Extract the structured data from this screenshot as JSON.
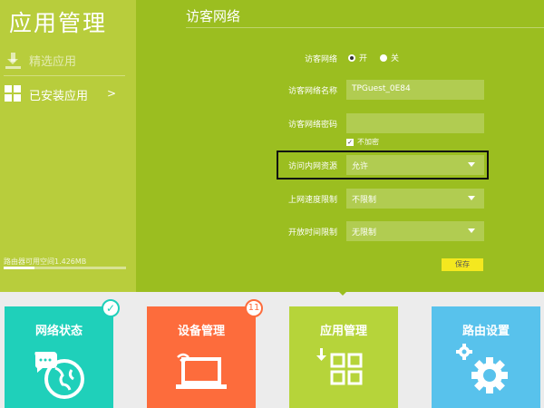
{
  "sidebar": {
    "app_title": "应用管理",
    "items": [
      {
        "label": "精选应用",
        "icon": "download-icon"
      },
      {
        "label": "已安装应用",
        "icon": "grid-icon",
        "chevron": ">"
      }
    ],
    "storage_label": "路由器可用空间1.426MB",
    "storage_fill_fraction": 0.25
  },
  "main": {
    "title": "访客网络",
    "form": {
      "guest_network_label": "访客网络",
      "radio_on_label": "开",
      "radio_off_label": "关",
      "radio_selected": "开",
      "ssid_label": "访客网络名称",
      "ssid_value": "TPGuest_0E84",
      "password_label": "访客网络密码",
      "password_value": "",
      "no_encrypt_label": "不加密",
      "no_encrypt_checked": true,
      "lan_access_label": "访问内网资源",
      "lan_access_value": "允许",
      "speed_label": "上网速度限制",
      "speed_value": "不限制",
      "time_label": "开放时间限制",
      "time_value": "无限制",
      "save_label": "保存"
    }
  },
  "tiles": [
    {
      "label": "网络状态",
      "color": "#1fd0ba",
      "icon": "globe-icon",
      "badge": "✓"
    },
    {
      "label": "设备管理",
      "color": "#fd6c3c",
      "icon": "laptop-icon",
      "badge": "11"
    },
    {
      "label": "应用管理",
      "color": "#b6d43a",
      "icon": "apps-grid-icon"
    },
    {
      "label": "路由设置",
      "color": "#58c2ec",
      "icon": "gear-icon"
    }
  ],
  "colors": {
    "sidebar_bg": "#b8cd3c",
    "main_bg": "#9bbe20",
    "save_button": "#f4e81f"
  }
}
